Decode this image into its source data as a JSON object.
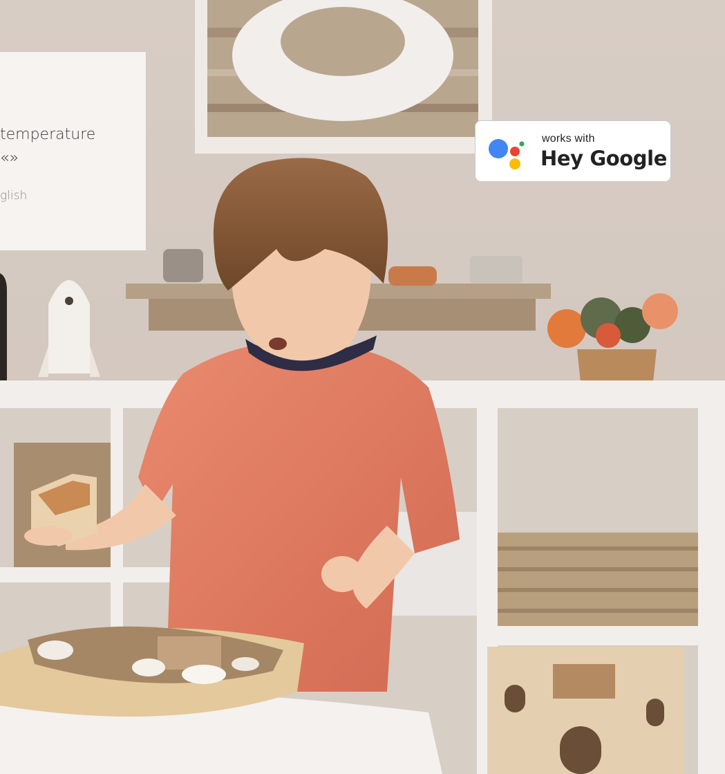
{
  "card": {
    "line1": "temperature",
    "line2": "«»",
    "language": "glish"
  },
  "badge": {
    "small_text": "works with",
    "big_text": "Hey Google"
  },
  "colors": {
    "google_blue": "#4285F4",
    "google_red": "#EA4335",
    "google_yellow": "#FBBC05",
    "google_green": "#34A853"
  }
}
